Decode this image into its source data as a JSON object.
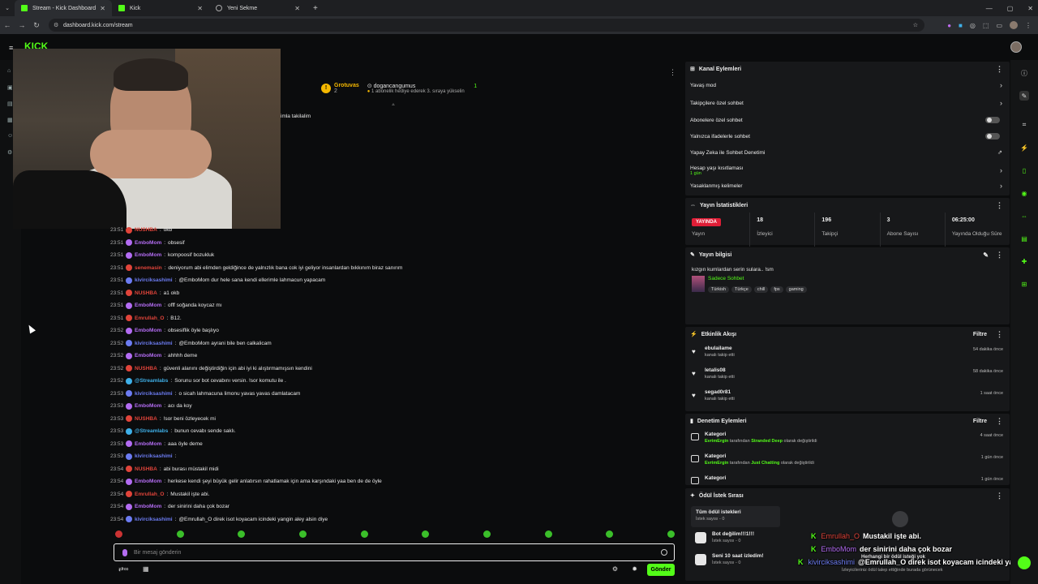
{
  "browser": {
    "tabs": [
      {
        "label": "Stream - Kick Dashboard",
        "active": true
      },
      {
        "label": "Kick",
        "active": false
      },
      {
        "label": "Yeni Sekme",
        "active": false
      }
    ],
    "url": "dashboard.kick.com/stream"
  },
  "pinned": {
    "user": "Grotuvas",
    "count": "2",
    "gifter": "dogancangumus",
    "gift_count": "1",
    "message": "1 abonelik hediye ederek 3. sıraya yükselin",
    "partial_text": "imla takilalim"
  },
  "chat": {
    "messages": [
      {
        "time": "23:51",
        "user": "NUSHBA",
        "text": "okb",
        "color": "#e0443a"
      },
      {
        "time": "23:51",
        "user": "EmboMom",
        "text": "obsesif",
        "color": "#b36cf2"
      },
      {
        "time": "23:51",
        "user": "EmboMom",
        "text": "kompoosif bozukluk",
        "color": "#b36cf2"
      },
      {
        "time": "23:51",
        "user": "senemasin",
        "text": "deniyorum abi elimden geldiğince de yalnızlık bana cok iyi geliyor insanlardan bıkkınım biraz sanırım",
        "color": "#e0443a"
      },
      {
        "time": "23:51",
        "user": "kivirciksashimi",
        "text": "@EmboMom dur hele sana kendi ellerimle lahmacun yapacam",
        "color": "#6c7cf2"
      },
      {
        "time": "23:51",
        "user": "NUSHBA",
        "text": "a1 okb",
        "color": "#e0443a"
      },
      {
        "time": "23:51",
        "user": "EmboMom",
        "text": "offf soğanda koycaz mı",
        "color": "#b36cf2"
      },
      {
        "time": "23:51",
        "user": "Emrullah_O",
        "text": "B12.",
        "color": "#e0443a"
      },
      {
        "time": "23:52",
        "user": "EmboMom",
        "text": "obsesiflik öyle başlıyo",
        "color": "#b36cf2"
      },
      {
        "time": "23:52",
        "user": "kivirciksashimi",
        "text": "@EmboMom ayrani bile ben calkalicam",
        "color": "#6c7cf2"
      },
      {
        "time": "23:52",
        "user": "EmboMom",
        "text": "ahhhh deme",
        "color": "#b36cf2"
      },
      {
        "time": "23:52",
        "user": "NUSHBA",
        "text": "güvenli alanını değiştirdiğin için abi iyi ki alıştırmamışsın kendini",
        "color": "#e0443a"
      },
      {
        "time": "23:52",
        "user": "@Streamlabs",
        "text": "Sorunu sor bot cevabını versin. !sor komutu ile .",
        "color": "#3fb0e8"
      },
      {
        "time": "23:53",
        "user": "kivirciksashimi",
        "text": "o sicah lahmacuna limonu yavas yavas damlatacam",
        "color": "#6c7cf2"
      },
      {
        "time": "23:53",
        "user": "EmboMom",
        "text": "acı da koy",
        "color": "#b36cf2"
      },
      {
        "time": "23:53",
        "user": "NUSHBA",
        "text": "!sor beni özleyecek mi",
        "color": "#e0443a"
      },
      {
        "time": "23:53",
        "user": "@Streamlabs",
        "text": "bunun cevabı sende saklı.",
        "color": "#3fb0e8"
      },
      {
        "time": "23:53",
        "user": "EmboMom",
        "text": "aaa öyle deme",
        "color": "#b36cf2"
      },
      {
        "time": "23:53",
        "user": "kivirciksashimi",
        "text": "",
        "color": "#6c7cf2"
      },
      {
        "time": "23:54",
        "user": "NUSHBA",
        "text": "abi burası müstakil mi​di",
        "color": "#e0443a"
      },
      {
        "time": "23:54",
        "user": "EmboMom",
        "text": "herkese kendi şeyi büyük gelir anlatırsın rahatlamak için ama karşındaki yaa ben de de öyle",
        "color": "#b36cf2"
      },
      {
        "time": "23:54",
        "user": "Emrullah_O",
        "text": "Mustakil işte abi.",
        "color": "#e0443a"
      },
      {
        "time": "23:54",
        "user": "EmboMom",
        "text": "der sinirini daha çok bozar",
        "color": "#b36cf2"
      },
      {
        "time": "23:54",
        "user": "kivirciksashimi",
        "text": "@Emrullah_O direk isot koyacam icindeki yangin aley alsin diye",
        "color": "#6c7cf2"
      }
    ],
    "input_placeholder": "Bir mesaj gönderin",
    "send_label": "Gönder"
  },
  "channel_actions": {
    "title": "Kanal Eylemleri",
    "items": [
      {
        "label": "Yavaş mod",
        "control": "arrow"
      },
      {
        "label": "Takipçilere özel sohbet",
        "control": "arrow"
      },
      {
        "label": "Abonelere özel sohbet",
        "control": "toggle"
      },
      {
        "label": "Yalnızca ifadelerle sohbet",
        "control": "toggle"
      },
      {
        "label": "Yapay Zeka ile Sohbet Denetimi",
        "control": "external"
      },
      {
        "label": "Hesap yaşı kısıtlaması",
        "sub": "1 gün",
        "control": "arrow"
      },
      {
        "label": "Yasaklanmış kelimeler",
        "control": "arrow"
      }
    ]
  },
  "stream_stats": {
    "title": "Yayın İstatistikleri",
    "status": "YAYINDA",
    "status_label": "Yayın",
    "cells": [
      {
        "value": "18",
        "label": "İzleyici"
      },
      {
        "value": "196",
        "label": "Takipçi"
      },
      {
        "value": "3",
        "label": "Abone Sayısı"
      },
      {
        "value": "06:25:00",
        "label": "Yayında Olduğu Süre"
      }
    ]
  },
  "stream_info": {
    "title": "Yayın bilgisi",
    "stream_title": "kızgın kumlardan serin sulara.. !sm",
    "category": "Sadece Sohbet",
    "tags": [
      "Türkish",
      "Türkçe",
      "chill",
      "fps",
      "gaming"
    ]
  },
  "activity": {
    "title": "Etkinlik Akışı",
    "filter": "Filtre",
    "items": [
      {
        "name": "ebulailame",
        "sub": "kanalı takip etti",
        "time": "54 dakika önce"
      },
      {
        "name": "letalis08",
        "sub": "kanalı takip etti",
        "time": "58 dakika önce"
      },
      {
        "name": "segad0r81",
        "sub": "kanalı takip etti",
        "time": "1 saat önce"
      }
    ]
  },
  "moderation": {
    "title": "Denetim Eylemleri",
    "filter": "Filtre",
    "items": [
      {
        "name": "Kategori",
        "actor": "EvrimErgin",
        "mid": "tarafından",
        "target": "Stranded Deep",
        "end": "olarak değiştirildi",
        "time": "4 saat önce"
      },
      {
        "name": "Kategori",
        "actor": "EvrimErgin",
        "mid": "tarafından",
        "target": "Just Chatting",
        "end": "olarak değiştirildi",
        "time": "1 gün önce"
      },
      {
        "name": "Kategori",
        "actor": "",
        "mid": "",
        "target": "",
        "end": "",
        "time": "1 gün önce"
      }
    ]
  },
  "rewards": {
    "title": "Ödül İstek Sırası",
    "items": [
      {
        "name": "Tüm ödül istekleri",
        "sub": "İstek sayısı - 0"
      },
      {
        "name": "Bot değilim!!!1!!!",
        "sub": "İstek sayısı - 0"
      },
      {
        "name": "Seni 10 saat izledim!",
        "sub": "İstek sayısı - 0"
      }
    ]
  },
  "overlay": {
    "lines": [
      {
        "user": "Emrullah_O",
        "text": "Mustakil işte abi."
      },
      {
        "user": "EmboMom",
        "text": "der sinirini daha çok bozar"
      },
      {
        "user": "kivirciksashimi",
        "text": "@Emrullah_O direk isot koyacam icindeki yangin aley alsin diye"
      }
    ],
    "under": "Herhangi bir ödül isteği yok",
    "under2": "İzleyicileriniz ödül talep ettiğinde burada görünecek"
  },
  "colors": {
    "brand": "#53fc18",
    "live": "#e01e37"
  }
}
